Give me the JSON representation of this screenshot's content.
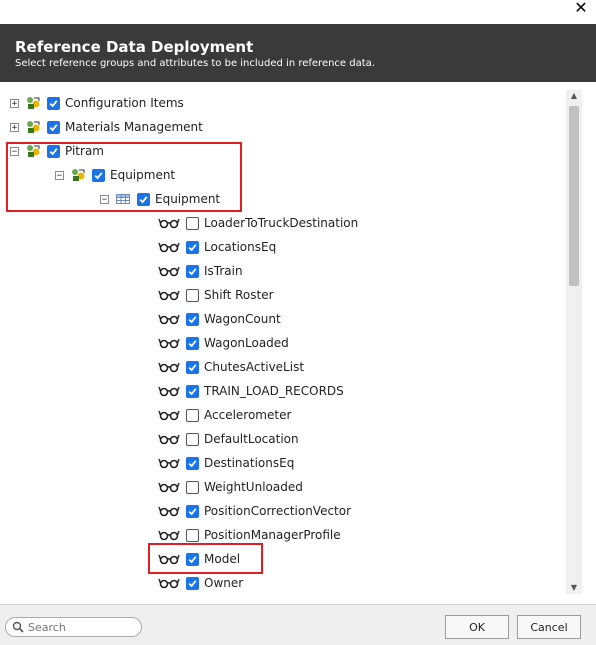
{
  "dialog": {
    "title": "Reference Data Deployment",
    "subtitle": "Select reference groups and attributes to be included in reference data.",
    "close_icon": "close-icon"
  },
  "colors": {
    "header_bg": "#3a3a3a",
    "checkbox_checked": "#1a73e8",
    "highlight": "#e01e26"
  },
  "tree": {
    "groups": [
      {
        "label": "Configuration Items",
        "expander": "+",
        "checked": true
      },
      {
        "label": "Materials Management",
        "expander": "+",
        "checked": true
      },
      {
        "label": "Pitram",
        "expander": "−",
        "checked": true
      }
    ],
    "subgroup": {
      "label": "Equipment",
      "expander": "−",
      "checked": true
    },
    "table": {
      "label": "Equipment",
      "expander": "−",
      "checked": true
    },
    "attributes": [
      {
        "label": "LoaderToTruckDestination",
        "checked": false
      },
      {
        "label": "LocationsEq",
        "checked": true
      },
      {
        "label": "IsTrain",
        "checked": true
      },
      {
        "label": "Shift Roster",
        "checked": false
      },
      {
        "label": "WagonCount",
        "checked": true
      },
      {
        "label": "WagonLoaded",
        "checked": true
      },
      {
        "label": "ChutesActiveList",
        "checked": true
      },
      {
        "label": "TRAIN_LOAD_RECORDS",
        "checked": true
      },
      {
        "label": "Accelerometer",
        "checked": false
      },
      {
        "label": "DefaultLocation",
        "checked": false
      },
      {
        "label": "DestinationsEq",
        "checked": true
      },
      {
        "label": "WeightUnloaded",
        "checked": false
      },
      {
        "label": "PositionCorrectionVector",
        "checked": true
      },
      {
        "label": "PositionManagerProfile",
        "checked": false
      },
      {
        "label": "Model",
        "checked": true
      },
      {
        "label": "Owner",
        "checked": true
      }
    ]
  },
  "footer": {
    "search_placeholder": "Search",
    "ok_label": "OK",
    "cancel_label": "Cancel"
  }
}
